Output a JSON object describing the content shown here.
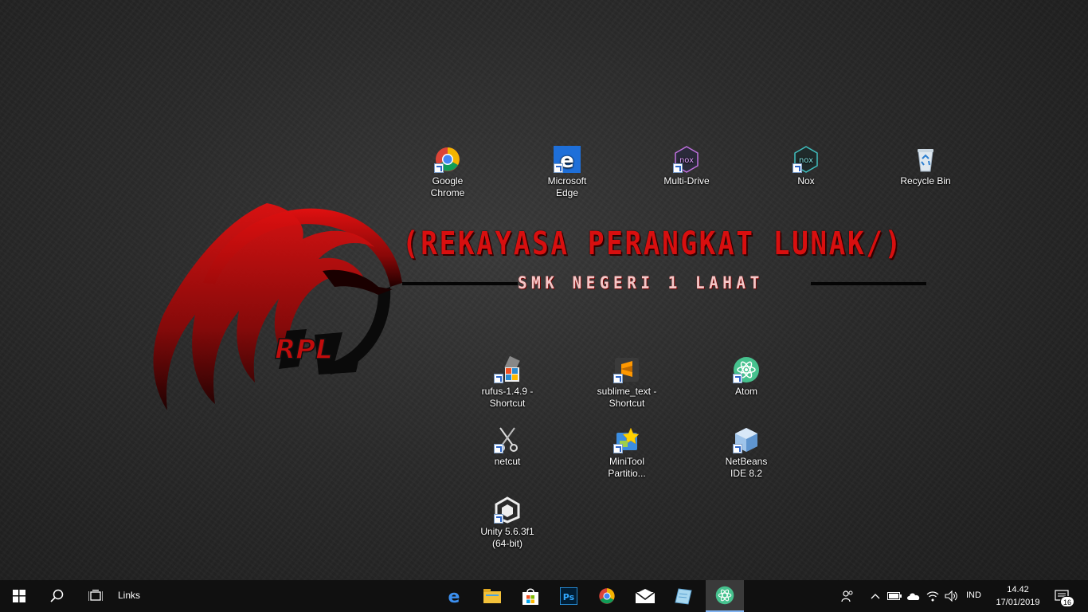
{
  "wallpaper": {
    "title": "(REKAYASA PERANGKAT LUNAK/)",
    "subtitle": "SMK NEGERI 1 LAHAT",
    "logo_text": "RPL",
    "accent_color": "#d80f0f"
  },
  "desktop_icons": [
    {
      "label": "Google Chrome",
      "icon": "chrome-icon"
    },
    {
      "label": "Microsoft Edge",
      "icon": "edge-icon"
    },
    {
      "label": "Multi-Drive",
      "icon": "nox-multidrive-icon"
    },
    {
      "label": "Nox",
      "icon": "nox-icon"
    },
    {
      "label": "Recycle Bin",
      "icon": "recycle-bin-icon"
    },
    {
      "label": "rufus-1.4.9 - Shortcut",
      "icon": "rufus-icon"
    },
    {
      "label": "sublime_text - Shortcut",
      "icon": "sublime-text-icon"
    },
    {
      "label": "Atom",
      "icon": "atom-icon"
    },
    {
      "label": "netcut",
      "icon": "netcut-icon"
    },
    {
      "label": "MiniTool Partitio...",
      "icon": "minitool-icon"
    },
    {
      "label": "NetBeans IDE 8.2",
      "icon": "netbeans-icon"
    },
    {
      "label": "Unity 5.6.3f1 (64-bit)",
      "icon": "unity-icon"
    }
  ],
  "taskbar": {
    "links_label": "Links",
    "pinned_apps": [
      "edge-icon",
      "file-explorer-icon",
      "store-icon",
      "photoshop-icon",
      "chrome-icon",
      "mail-icon",
      "notepad-icon",
      "atom-icon"
    ],
    "photoshop_label": "Ps",
    "language": "IND",
    "time": "14.42",
    "date": "17/01/2019",
    "notification_count": "16"
  }
}
